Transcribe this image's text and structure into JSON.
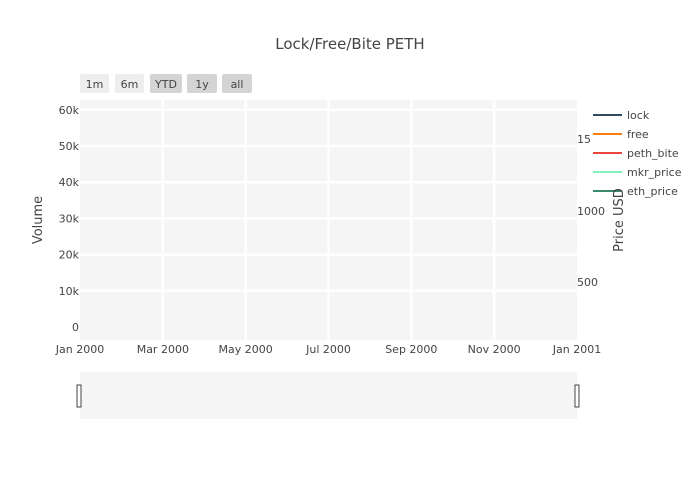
{
  "chart_data": {
    "type": "line",
    "title": "Lock/Free/Bite PETH",
    "xlabel": "",
    "ylabel": "Volume",
    "y2label": "Price USD",
    "x_ticks": [
      "Jan 2000",
      "Mar 2000",
      "May 2000",
      "Jul 2000",
      "Sep 2000",
      "Nov 2000",
      "Jan 2001"
    ],
    "y_ticks": [
      "0",
      "10k",
      "20k",
      "30k",
      "40k",
      "50k",
      "60k"
    ],
    "y2_ticks": [
      "500",
      "1000",
      "15"
    ],
    "ylim": [
      0,
      62000
    ],
    "y2_visible_ticks": [
      500,
      1000,
      1500
    ],
    "grid": true,
    "legend_position": "top-right",
    "range_selector": [
      {
        "label": "1m",
        "active": false
      },
      {
        "label": "6m",
        "active": false
      },
      {
        "label": "YTD",
        "active": true
      },
      {
        "label": "1y",
        "active": true
      },
      {
        "label": "all",
        "active": true
      }
    ],
    "series": [
      {
        "name": "lock",
        "color": "#2f4b5f",
        "values": []
      },
      {
        "name": "free",
        "color": "#ff7f0e",
        "values": []
      },
      {
        "name": "peth_bite",
        "color": "#e8453c",
        "values": []
      },
      {
        "name": "mkr_price",
        "color": "#7ff0b8",
        "values": []
      },
      {
        "name": "eth_price",
        "color": "#3a8a6a",
        "values": []
      }
    ]
  }
}
